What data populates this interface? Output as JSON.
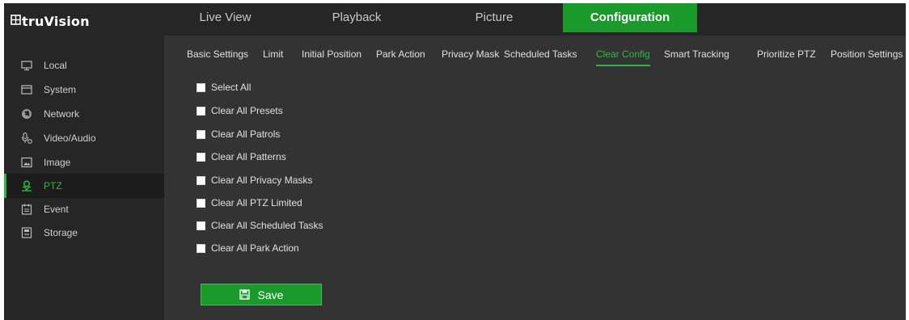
{
  "brand": {
    "logo_text": "truVision"
  },
  "top_nav": {
    "tabs": [
      {
        "label": "Live View"
      },
      {
        "label": "Playback"
      },
      {
        "label": "Picture"
      },
      {
        "label": "Configuration",
        "active": true
      }
    ]
  },
  "sidebar": {
    "items": [
      {
        "label": "Local",
        "icon": "monitor-icon"
      },
      {
        "label": "System",
        "icon": "window-icon"
      },
      {
        "label": "Network",
        "icon": "globe-icon"
      },
      {
        "label": "Video/Audio",
        "icon": "microphone-icon"
      },
      {
        "label": "Image",
        "icon": "image-icon"
      },
      {
        "label": "PTZ",
        "icon": "ptz-icon",
        "active": true
      },
      {
        "label": "Event",
        "icon": "calendar-icon"
      },
      {
        "label": "Storage",
        "icon": "storage-icon"
      }
    ]
  },
  "sub_tabs": [
    {
      "label": "Basic Settings"
    },
    {
      "label": "Limit"
    },
    {
      "label": "Initial Position"
    },
    {
      "label": "Park Action"
    },
    {
      "label": "Privacy Mask"
    },
    {
      "label": "Scheduled Tasks"
    },
    {
      "label": "Clear Config",
      "active": true
    },
    {
      "label": "Smart Tracking"
    },
    {
      "label": "Prioritize PTZ"
    },
    {
      "label": "Position Settings"
    }
  ],
  "options": [
    {
      "label": "Select All",
      "checked": false
    },
    {
      "label": "Clear All Presets",
      "checked": false
    },
    {
      "label": "Clear All Patrols",
      "checked": false
    },
    {
      "label": "Clear All Patterns",
      "checked": false
    },
    {
      "label": "Clear All Privacy Masks",
      "checked": false
    },
    {
      "label": "Clear All PTZ Limited",
      "checked": false
    },
    {
      "label": "Clear All Scheduled Tasks",
      "checked": false
    },
    {
      "label": "Clear All Park Action",
      "checked": false
    }
  ],
  "actions": {
    "save_label": "Save"
  },
  "colors": {
    "accent": "#1a9a2b",
    "accent_text": "#2db83d",
    "background": "#333333",
    "panel": "#262626"
  }
}
